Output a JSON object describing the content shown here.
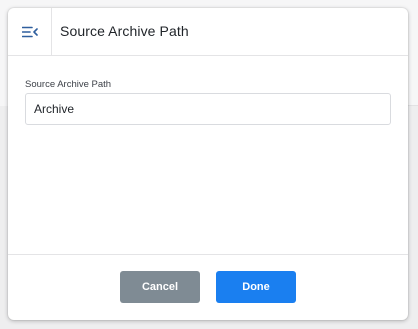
{
  "dialog": {
    "title": "Source Archive Path",
    "menu_icon": "collapse-menu-icon"
  },
  "field": {
    "label": "Source Archive Path",
    "value": "Archive"
  },
  "footer": {
    "cancel_label": "Cancel",
    "done_label": "Done"
  },
  "colors": {
    "primary": "#1a7ff0",
    "secondary": "#7f8b94"
  }
}
